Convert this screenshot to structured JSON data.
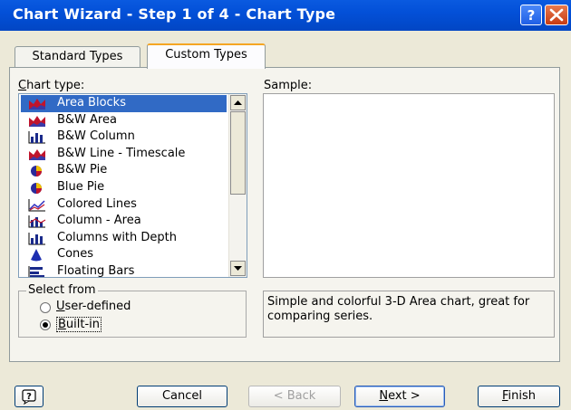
{
  "window": {
    "title": "Chart Wizard - Step 1 of 4 - Chart Type"
  },
  "tabs": [
    {
      "label": "Standard Types",
      "active": false
    },
    {
      "label": "Custom Types",
      "active": true
    }
  ],
  "chart_type": {
    "label_prefix": "C",
    "label_rest": "hart type:",
    "selected": "Area Blocks",
    "items": [
      {
        "label": "Area Blocks",
        "icon": "area-chart-icon"
      },
      {
        "label": "B&W Area",
        "icon": "area-chart-icon"
      },
      {
        "label": "B&W Column",
        "icon": "column-chart-icon"
      },
      {
        "label": "B&W Line - Timescale",
        "icon": "area-chart-icon"
      },
      {
        "label": "B&W Pie",
        "icon": "pie-chart-icon"
      },
      {
        "label": "Blue Pie",
        "icon": "pie-chart-icon"
      },
      {
        "label": "Colored Lines",
        "icon": "line-chart-icon"
      },
      {
        "label": "Column - Area",
        "icon": "column-area-chart-icon"
      },
      {
        "label": "Columns with Depth",
        "icon": "column-chart-icon"
      },
      {
        "label": "Cones",
        "icon": "cone-chart-icon"
      },
      {
        "label": "Floating Bars",
        "icon": "bar-chart-icon"
      }
    ]
  },
  "sample": {
    "label": "Sample:"
  },
  "select_from": {
    "legend": "Select from",
    "options": [
      {
        "prefix": "",
        "underline": "U",
        "rest": "ser-defined",
        "checked": false
      },
      {
        "prefix": "",
        "underline": "B",
        "rest": "uilt-in",
        "checked": true
      }
    ]
  },
  "description": "Simple and colorful 3-D Area chart, great for comparing series.",
  "buttons": {
    "cancel": "Cancel",
    "back": "< Back",
    "next_underline": "N",
    "next_rest": "ext >",
    "finish_underline": "F",
    "finish_rest": "inish"
  },
  "colors": {
    "titlebar": "#0350d8",
    "selection": "#316ac5",
    "active_tab_accent": "#f5a623",
    "close_button": "#c73a12"
  }
}
